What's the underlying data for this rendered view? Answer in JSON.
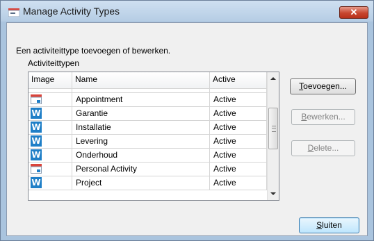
{
  "window": {
    "title": "Manage Activity Types",
    "close_label": "✕"
  },
  "description": "Een activiteittype toevoegen of bewerken.",
  "group_label": "Activiteittypen",
  "table": {
    "columns": [
      "Image",
      "Name",
      "Active"
    ],
    "rows": [
      {
        "icon": "calendar-icon",
        "name": "Appointment",
        "active": "Active"
      },
      {
        "icon": "word-icon",
        "name": "Garantie",
        "active": "Active"
      },
      {
        "icon": "word-icon",
        "name": "Installatie",
        "active": "Active"
      },
      {
        "icon": "word-icon",
        "name": "Levering",
        "active": "Active"
      },
      {
        "icon": "word-icon",
        "name": "Onderhoud",
        "active": "Active"
      },
      {
        "icon": "calendar-icon",
        "name": "Personal Activity",
        "active": "Active"
      },
      {
        "icon": "word-icon",
        "name": "Project",
        "active": "Active"
      }
    ]
  },
  "buttons": {
    "add_first": "T",
    "add_rest": "oevoegen...",
    "edit_first": "B",
    "edit_rest": "ewerken...",
    "delete_first": "D",
    "delete_rest": "elete...",
    "close_first": "S",
    "close_rest": "luiten"
  },
  "colors": {
    "word_icon": "#1f7fc7",
    "calendar_red": "#d9443b",
    "default_button_border": "#3c7fb1"
  }
}
